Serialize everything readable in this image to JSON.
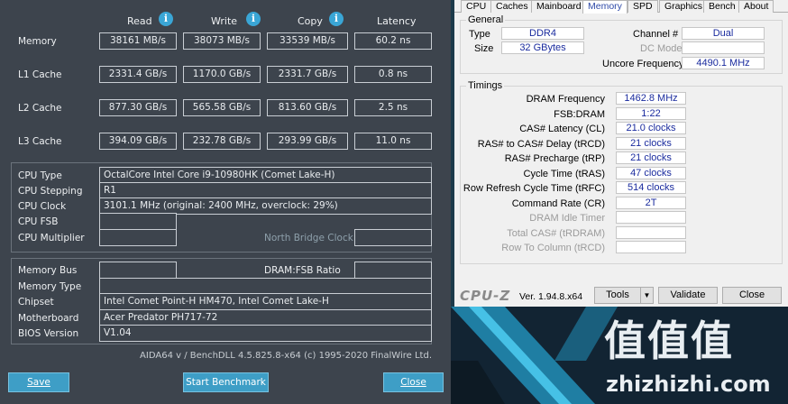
{
  "aida": {
    "columns": [
      {
        "label": "Read"
      },
      {
        "label": "Write"
      },
      {
        "label": "Copy"
      },
      {
        "label": "Latency"
      }
    ],
    "bench_rows": [
      {
        "label": "Memory",
        "read": "38161 MB/s",
        "write": "38073 MB/s",
        "copy": "33539 MB/s",
        "latency": "60.2 ns"
      },
      {
        "label": "L1 Cache",
        "read": "2331.4 GB/s",
        "write": "1170.0 GB/s",
        "copy": "2331.7 GB/s",
        "latency": "0.8 ns"
      },
      {
        "label": "L2 Cache",
        "read": "877.30 GB/s",
        "write": "565.58 GB/s",
        "copy": "813.60 GB/s",
        "latency": "2.5 ns"
      },
      {
        "label": "L3 Cache",
        "read": "394.09 GB/s",
        "write": "232.78 GB/s",
        "copy": "293.99 GB/s",
        "latency": "11.0 ns"
      }
    ],
    "cpu": {
      "type_label": "CPU Type",
      "type_value": "OctalCore Intel Core i9-10980HK  (Comet Lake-H)",
      "stepping_label": "CPU Stepping",
      "stepping_value": "R1",
      "clock_label": "CPU Clock",
      "clock_value": "3101.1 MHz  (original: 2400 MHz, overclock: 29%)",
      "fsb_label": "CPU FSB",
      "fsb_value": "",
      "multiplier_label": "CPU Multiplier",
      "multiplier_value": "",
      "north_bridge_label": "North Bridge Clock",
      "north_bridge_value": ""
    },
    "mem": {
      "bus_label": "Memory Bus",
      "bus_value": "",
      "dram_fsb_label": "DRAM:FSB Ratio",
      "dram_fsb_value": "",
      "type_label": "Memory Type",
      "type_value": "",
      "chipset_label": "Chipset",
      "chipset_value": "Intel Comet Point-H HM470, Intel Comet Lake-H",
      "motherboard_label": "Motherboard",
      "motherboard_value": "Acer Predator PH717-72",
      "bios_label": "BIOS Version",
      "bios_value": "V1.04"
    },
    "footer": "AIDA64 v / BenchDLL 4.5.825.8-x64  (c) 1995-2020 FinalWire Ltd.",
    "buttons": {
      "save": "Save",
      "start": "Start Benchmark",
      "close": "Close"
    }
  },
  "cpuz": {
    "tabs": [
      "CPU",
      "Caches",
      "Mainboard",
      "Memory",
      "SPD",
      "Graphics",
      "Bench",
      "About"
    ],
    "active_tab": "Memory",
    "general": {
      "title": "General",
      "type_label": "Type",
      "type_value": "DDR4",
      "size_label": "Size",
      "size_value": "32 GBytes",
      "channel_label": "Channel #",
      "channel_value": "Dual",
      "dc_mode_label": "DC Mode",
      "dc_mode_value": "",
      "uncore_label": "Uncore Frequency",
      "uncore_value": "4490.1 MHz"
    },
    "timings": {
      "title": "Timings",
      "rows": [
        {
          "label": "DRAM Frequency",
          "value": "1462.8 MHz",
          "dim": false
        },
        {
          "label": "FSB:DRAM",
          "value": "1:22",
          "dim": false
        },
        {
          "label": "CAS# Latency (CL)",
          "value": "21.0 clocks",
          "dim": false
        },
        {
          "label": "RAS# to CAS# Delay (tRCD)",
          "value": "21 clocks",
          "dim": false
        },
        {
          "label": "RAS# Precharge (tRP)",
          "value": "21 clocks",
          "dim": false
        },
        {
          "label": "Cycle Time (tRAS)",
          "value": "47 clocks",
          "dim": false
        },
        {
          "label": "Row Refresh Cycle Time (tRFC)",
          "value": "514 clocks",
          "dim": false
        },
        {
          "label": "Command Rate (CR)",
          "value": "2T",
          "dim": false
        },
        {
          "label": "DRAM Idle Timer",
          "value": "",
          "dim": true
        },
        {
          "label": "Total CAS# (tRDRAM)",
          "value": "",
          "dim": true
        },
        {
          "label": "Row To Column (tRCD)",
          "value": "",
          "dim": true
        }
      ]
    },
    "logo": "CPU-Z",
    "version": "Ver. 1.94.8.x64",
    "buttons": {
      "tools": "Tools",
      "validate": "Validate",
      "close": "Close"
    }
  },
  "watermark": {
    "big": "值值值",
    "url": "zhizhizhi.com"
  },
  "colors": {
    "aida_bg": "#3d444d",
    "aida_button": "#3e9ec6",
    "cpuz_value": "#1a2b9e",
    "info_icon": "#3aa6d6"
  }
}
